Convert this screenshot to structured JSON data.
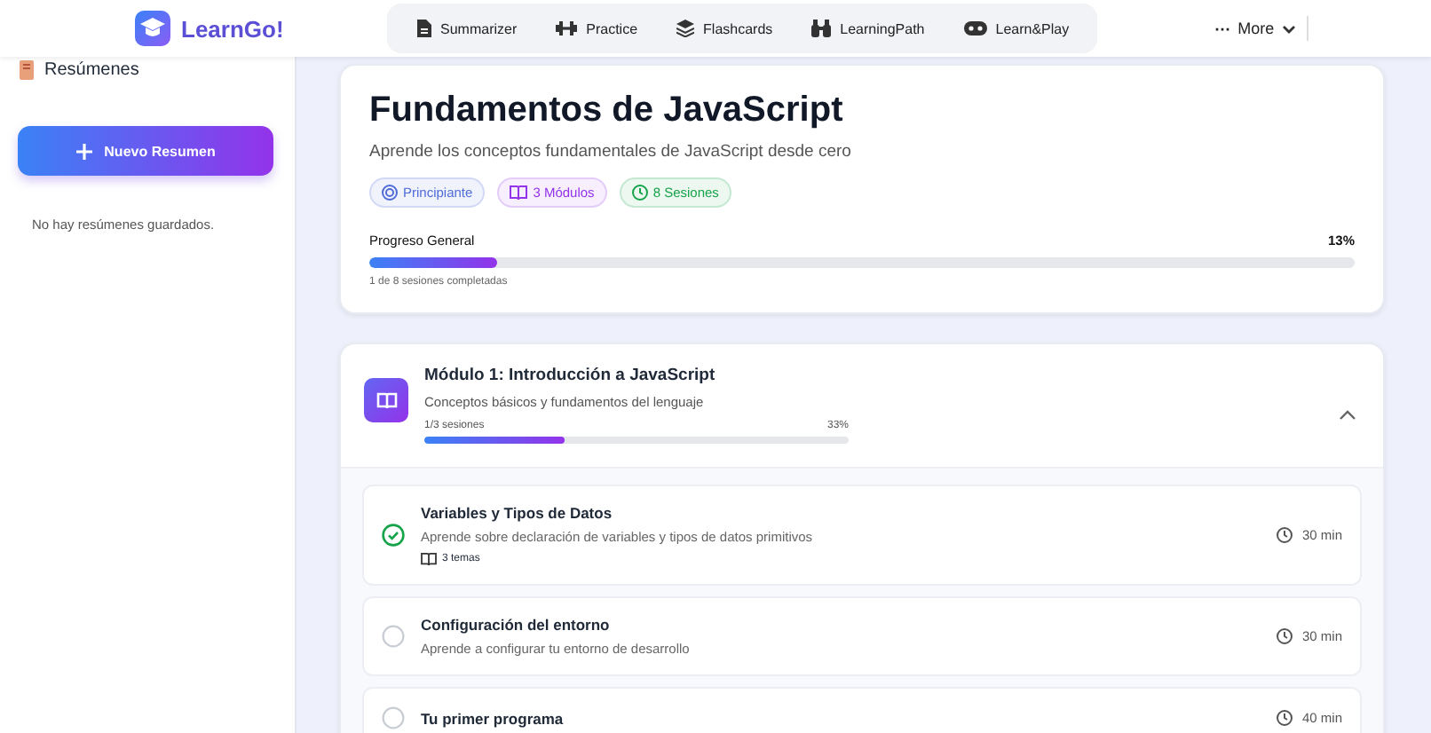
{
  "brand": {
    "name": "LearnGo!"
  },
  "nav": [
    {
      "label": "Summarizer",
      "kind": "doc"
    },
    {
      "label": "Practice",
      "kind": "dumbbell"
    },
    {
      "label": "Flashcards",
      "kind": "layers"
    },
    {
      "label": "LearningPath",
      "kind": "binoculars"
    },
    {
      "label": "Learn&Play",
      "kind": "gamepad"
    }
  ],
  "more": {
    "icon": "⋯",
    "label": "More"
  },
  "sidebar": {
    "title": "Resúmenes",
    "button": "Nuevo Resumen",
    "empty": "No hay resúmenes guardados."
  },
  "course": {
    "title": "Fundamentos de JavaScript",
    "subtitle": "Aprende los conceptos fundamentales de JavaScript desde cero",
    "badges": [
      {
        "kind": "level",
        "label": "Principiante",
        "color": "#4f6bd8"
      },
      {
        "kind": "modules",
        "label": "3 Módulos",
        "color": "#9333ea"
      },
      {
        "kind": "sessions",
        "label": "8 Sesiones",
        "color": "#16a34a"
      }
    ],
    "progress_label": "Progreso General",
    "progress_value": "13%",
    "level": 0.13,
    "progress_note": "1 de 8 sesiones completadas"
  },
  "module": {
    "title": "Módulo 1: Introducción a JavaScript",
    "subtitle": "Conceptos básicos y fundamentos del lenguaje",
    "sessions_label": "1/3 sesiones",
    "percent": "33%",
    "level": 0.33,
    "expanded": true,
    "sessions": [
      {
        "title": "Variables y Tipos de Datos",
        "description": "Aprende sobre declaración de variables y tipos de datos primitivos",
        "topics": "3 temas",
        "duration": "30 min",
        "completed": true
      },
      {
        "title": "Configuración del entorno",
        "description": "Aprende a configurar tu entorno de desarrollo",
        "duration": "30 min",
        "completed": false
      },
      {
        "title": "Tu primer programa",
        "duration": "40 min",
        "completed": false
      }
    ]
  }
}
